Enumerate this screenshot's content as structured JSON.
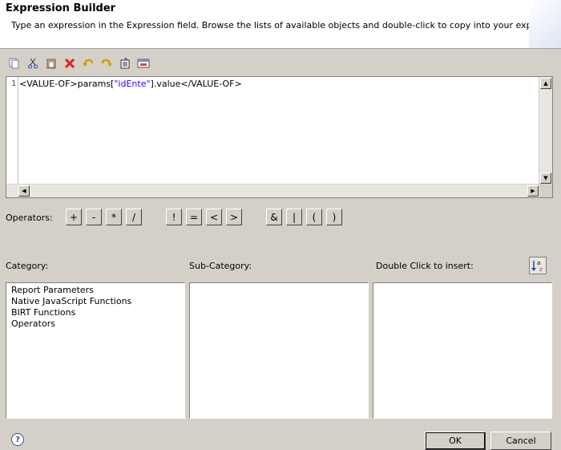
{
  "dialog": {
    "title": "Expression Builder",
    "description": "Type an expression in the Expression field. Browse the lists of available objects and double-click to copy into your expression."
  },
  "toolbar": {
    "icons": [
      "copy-icon",
      "cut-icon",
      "paste-icon",
      "delete-icon",
      "undo-icon",
      "redo-icon",
      "select-all-icon",
      "validate-icon"
    ]
  },
  "editor": {
    "line_number": "1",
    "code_prefix": "<VALUE-OF>params[",
    "code_string": "\"idEnte\"",
    "code_suffix": "].value</VALUE-OF>"
  },
  "operators": {
    "label": "Operators:",
    "buttons": [
      "+",
      "-",
      "*",
      "/",
      "!",
      "=",
      "<",
      ">",
      "&",
      "|",
      "(",
      ")"
    ]
  },
  "panels": {
    "category_label": "Category:",
    "subcategory_label": "Sub-Category:",
    "insert_label": "Double Click to insert:",
    "category_items": [
      "Report Parameters",
      "Native JavaScript Functions",
      "BIRT Functions",
      "Operators"
    ]
  },
  "footer": {
    "help": "?",
    "ok_label": "OK",
    "cancel_label": "Cancel"
  }
}
